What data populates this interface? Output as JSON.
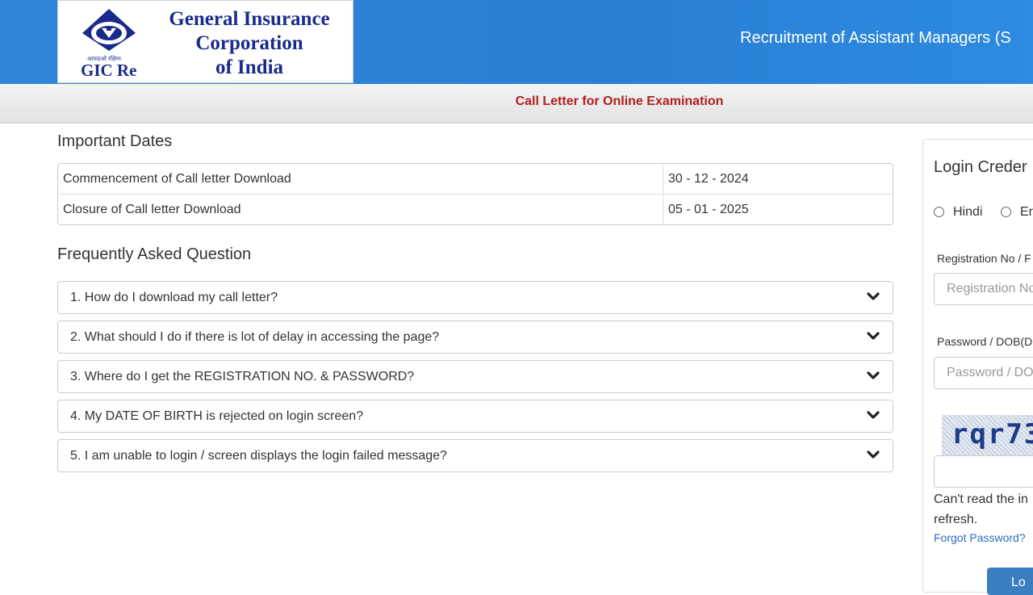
{
  "header": {
    "logo": {
      "org_name_lines": [
        "General Insurance",
        "Corporation",
        "of India"
      ],
      "hindi_tagline": "आपदाओं रक्षिणः",
      "brand": "GIC Re",
      "brand_color": "#1a2a8a"
    },
    "title": "Recruitment of Assistant Managers (S",
    "bg_color": "#2f86d8"
  },
  "subheader": {
    "title": "Call Letter for Online Examination",
    "title_color": "#b02020"
  },
  "important_dates": {
    "title": "Important Dates",
    "rows": [
      {
        "label": "Commencement of Call letter Download",
        "value": "30 - 12 - 2024"
      },
      {
        "label": "Closure of Call letter Download",
        "value": "05 - 01 - 2025"
      }
    ]
  },
  "faq": {
    "title": "Frequently Asked Question",
    "items": [
      {
        "question": "1. How do I download my call letter?",
        "icon": "chevron-down-icon"
      },
      {
        "question": "2. What should I do if there is lot of delay in accessing the page?",
        "icon": "chevron-down-icon"
      },
      {
        "question": "3. Where do I get the REGISTRATION NO. & PASSWORD?",
        "icon": "chevron-down-icon"
      },
      {
        "question": "4. My DATE OF BIRTH is rejected on login screen?",
        "icon": "chevron-down-icon"
      },
      {
        "question": "5. I am unable to login / screen displays the login failed message?",
        "icon": "chevron-down-icon"
      }
    ]
  },
  "login": {
    "title": "Login Creder",
    "language_options": [
      "Hindi",
      "Er"
    ],
    "registration_label": "Registration No / F",
    "registration_placeholder": "Registration No",
    "password_label": "Password / DOB(D",
    "password_placeholder": "Password / DO",
    "captcha_text": "rqr73",
    "captcha_input_value": "",
    "help_line1": "Can't read the in",
    "help_line2": "refresh.",
    "forgot_password": "Forgot Password?",
    "login_button": "Lo",
    "link_color": "#2a6ebb",
    "button_color": "#3a7ec2"
  }
}
